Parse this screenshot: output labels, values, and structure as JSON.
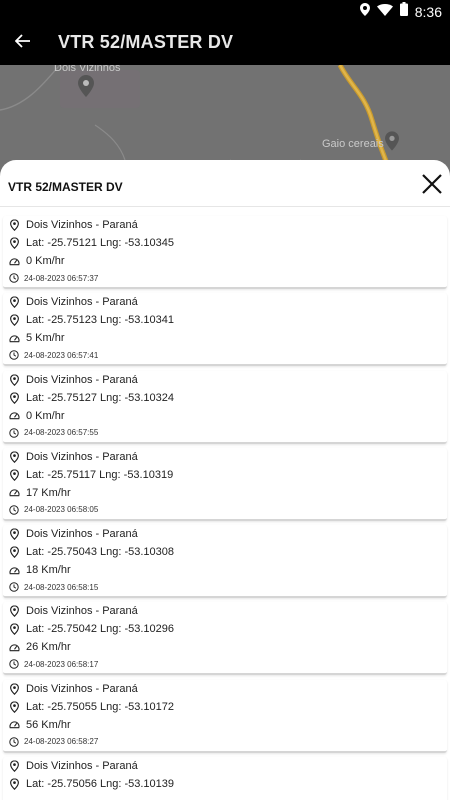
{
  "status_bar": {
    "time": "8:36"
  },
  "app_bar": {
    "title": "VTR 52/MASTER DV"
  },
  "map": {
    "labels": [
      "Dois Vizinhos",
      "Gaio cereais"
    ]
  },
  "sheet": {
    "title": "VTR 52/MASTER DV",
    "items": [
      {
        "place": "Dois Vizinhos - Paraná",
        "coords": "Lat: -25.75121 Lng: -53.10345",
        "speed": "0 Km/hr",
        "time": "24-08-2023 06:57:37"
      },
      {
        "place": "Dois Vizinhos - Paraná",
        "coords": "Lat: -25.75123 Lng: -53.10341",
        "speed": "5 Km/hr",
        "time": "24-08-2023 06:57:41"
      },
      {
        "place": "Dois Vizinhos - Paraná",
        "coords": "Lat: -25.75127 Lng: -53.10324",
        "speed": "0 Km/hr",
        "time": "24-08-2023 06:57:55"
      },
      {
        "place": "Dois Vizinhos - Paraná",
        "coords": "Lat: -25.75117 Lng: -53.10319",
        "speed": "17 Km/hr",
        "time": "24-08-2023 06:58:05"
      },
      {
        "place": "Dois Vizinhos - Paraná",
        "coords": "Lat: -25.75043 Lng: -53.10308",
        "speed": "18 Km/hr",
        "time": "24-08-2023 06:58:15"
      },
      {
        "place": "Dois Vizinhos - Paraná",
        "coords": "Lat: -25.75042 Lng: -53.10296",
        "speed": "26 Km/hr",
        "time": "24-08-2023 06:58:17"
      },
      {
        "place": "Dois Vizinhos - Paraná",
        "coords": "Lat: -25.75055 Lng: -53.10172",
        "speed": "56 Km/hr",
        "time": "24-08-2023 06:58:27"
      },
      {
        "place": "Dois Vizinhos - Paraná",
        "coords": "Lat: -25.75056 Lng: -53.10139",
        "speed": "",
        "time": ""
      }
    ]
  },
  "icons": {
    "location": "location-pin-icon",
    "speed": "speedometer-icon",
    "clock": "clock-icon",
    "back": "arrow-back-icon",
    "close": "close-icon"
  }
}
